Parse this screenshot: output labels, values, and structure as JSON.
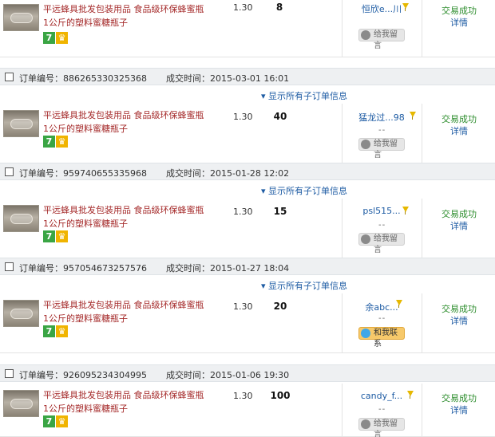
{
  "labels": {
    "order_no": "订单编号：",
    "deal_time": "成交时间：",
    "expand": "▾ 显示所有子订单信息",
    "status": "交易成功",
    "detail": "详情",
    "leave_msg": "给我留言",
    "contact": "和我联系"
  },
  "product": {
    "title_line1": "平远蜂具批发包装用品 食品级环保蜂蜜瓶",
    "title_line2": "1公斤的塑料蜜糖瓶子",
    "badge_seven": "7"
  },
  "orders": [
    {
      "order_no": "",
      "deal_time": "",
      "price": "1.30",
      "qty": "8",
      "buyer": "恒欣e...川",
      "msg_button": "给我留言"
    },
    {
      "order_no": "886265330325368",
      "deal_time": "2015-03-01 16:01",
      "price": "1.30",
      "qty": "40",
      "buyer": "猛龙过...98",
      "msg_button": "给我留言"
    },
    {
      "order_no": "959740655335968",
      "deal_time": "2015-01-28 12:02",
      "price": "1.30",
      "qty": "15",
      "buyer": "psl515...",
      "msg_button": "给我留言"
    },
    {
      "order_no": "957054673257576",
      "deal_time": "2015-01-27 18:04",
      "price": "1.30",
      "qty": "20",
      "buyer": "余abc...",
      "msg_button": "和我联系"
    },
    {
      "order_no": "926095234304995",
      "deal_time": "2015-01-06 19:30",
      "price": "1.30",
      "qty": "100",
      "buyer": "candy_f...",
      "msg_button": "给我留言"
    }
  ],
  "colors": {
    "title": "#a52a2a",
    "link": "#1d5ba3",
    "status": "#2b8c2b",
    "header_bg": "#eef0f2"
  }
}
